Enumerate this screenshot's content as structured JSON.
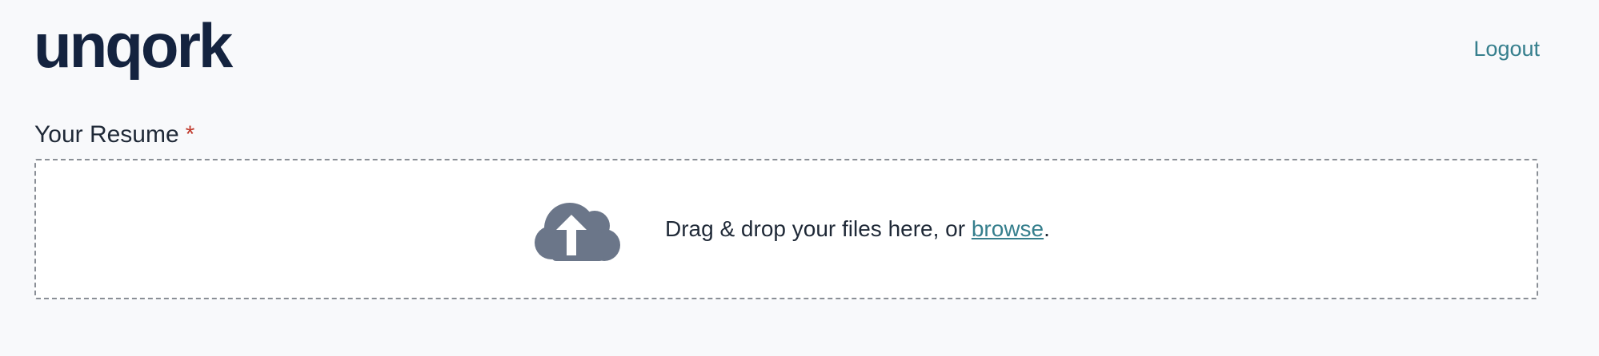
{
  "header": {
    "logo_text": "unqork",
    "logout_label": "Logout"
  },
  "form": {
    "resume_label": "Your Resume",
    "required_marker": "*",
    "dropzone": {
      "text_before": "Drag & drop your files here, or ",
      "browse_label": "browse",
      "text_after": ".",
      "icon": "cloud-upload-icon"
    }
  },
  "colors": {
    "logo": "#14233f",
    "link": "#367f8d",
    "required": "#c0392b",
    "icon": "#6b7689"
  }
}
